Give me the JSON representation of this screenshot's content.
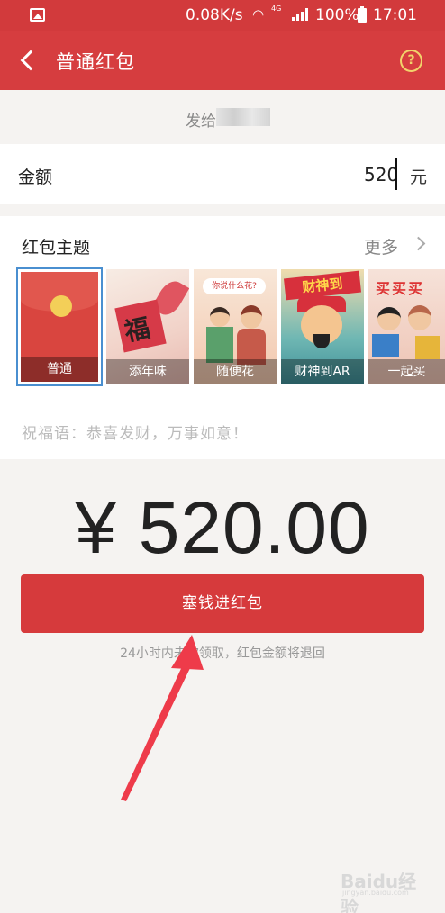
{
  "status_bar": {
    "net_speed": "0.08K/s",
    "network": "4G",
    "battery": "100%",
    "time": "17:01",
    "icons": [
      "image-icon",
      "wifi-icon",
      "signal-icon",
      "battery-icon"
    ]
  },
  "header": {
    "title": "普通红包",
    "back_icon": "back-arrow-icon",
    "help_label": "?"
  },
  "recipient": {
    "label": "发给"
  },
  "amount": {
    "label": "金额",
    "value": "520",
    "unit": "元"
  },
  "theme": {
    "heading": "红包主题",
    "more_label": "更多",
    "cards": [
      {
        "label": "普通",
        "selected": true
      },
      {
        "label": "添年味",
        "art_text": "福"
      },
      {
        "label": "随便花",
        "art_text": "你说什么花?"
      },
      {
        "label": "财神到AR",
        "art_text": "财神到"
      },
      {
        "label": "一起买",
        "art_text": "买买买"
      }
    ]
  },
  "blessing": {
    "text": "祝福语：恭喜发财，万事如意！"
  },
  "total": {
    "display": "¥ 520.00"
  },
  "submit": {
    "label": "塞钱进红包",
    "note": "24小时内未被领取，红包金额将退回"
  },
  "watermark": {
    "brand": "Baidu经验",
    "url": "jingyan.baidu.com"
  },
  "colors": {
    "brand_red": "#d63d3f",
    "button_red": "#d63a3c",
    "help_gold": "#f2d36b",
    "annotation_arrow": "#ee3b4a",
    "selected_border": "#4a8fd0"
  }
}
